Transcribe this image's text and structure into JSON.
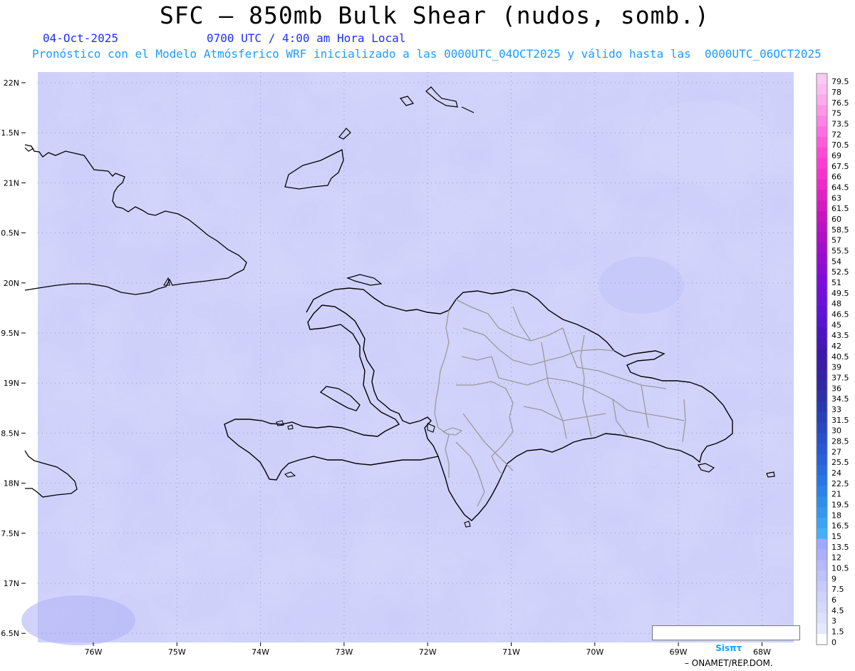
{
  "header": {
    "title": "SFC – 850mb Bulk Shear (nudos, somb.)",
    "date": "04-Oct-2025",
    "valid_time": "0700 UTC / 4:00 am Hora Local",
    "model_info": "Pronóstico con el Modelo Atmósferico WRF inicializado a las 0000UTC_04OCT2025 y válido hasta las  0000UTC_06OCT2025"
  },
  "map": {
    "lat_labels": [
      "22N",
      "1.5N",
      "21N",
      "0.5N",
      "20N",
      "9.5N",
      "19N",
      "8.5N",
      "18N",
      "7.5N",
      "17N",
      "6.5N"
    ],
    "lon_labels": [
      "76W",
      "75W",
      "74W",
      "73W",
      "72W",
      "71W",
      "70W",
      "69W",
      "68W"
    ],
    "field_color": "#cbcdfa",
    "coast_color": "#000000",
    "border_color": "#9a9a9a"
  },
  "colorbar": {
    "labels": [
      "79.5",
      "78",
      "76.5",
      "75",
      "73.5",
      "72",
      "70.5",
      "69",
      "67.5",
      "66",
      "64.5",
      "63",
      "61.5",
      "60",
      "58.5",
      "57",
      "55.5",
      "54",
      "52.5",
      "51",
      "49.5",
      "48",
      "46.5",
      "45",
      "43.5",
      "42",
      "40.5",
      "39",
      "37.5",
      "36",
      "34.5",
      "33",
      "31.5",
      "30",
      "28.5",
      "27",
      "25.5",
      "24",
      "22.5",
      "21",
      "19.5",
      "18",
      "16.5",
      "15",
      "13.5",
      "12",
      "10.5",
      "9",
      "7.5",
      "6",
      "4.5",
      "3",
      "1.5",
      "0"
    ],
    "colors": [
      "#ffc8f5",
      "#ffbcf2",
      "#ffaaee",
      "#ff96ea",
      "#ff82e6",
      "#ff6ee2",
      "#ff5cdc",
      "#ff4ad7",
      "#ff3cd2",
      "#f832cd",
      "#ee2ac8",
      "#e222c4",
      "#d51ac1",
      "#c814c0",
      "#bc10c4",
      "#b00ec8",
      "#a40ccc",
      "#980cd0",
      "#8c0cd6",
      "#800cdc",
      "#760ee0",
      "#6c10dc",
      "#6212d6",
      "#5814d0",
      "#4e14c4",
      "#4616b8",
      "#3e18ae",
      "#3a1ca8",
      "#3622a6",
      "#3228a6",
      "#2e30aa",
      "#2a38b0",
      "#2840b8",
      "#2848c2",
      "#2850ca",
      "#2858d2",
      "#2862da",
      "#286ce0",
      "#2876e6",
      "#2a82ea",
      "#2e8eee",
      "#3298f2",
      "#3aa4f6",
      "#44b0fa",
      "#a0a8ff",
      "#aab0ff",
      "#b4baff",
      "#bec2ff",
      "#c6caff",
      "#ced2ff",
      "#d6d9ff",
      "#dee0ff",
      "#e6e8ff",
      "#ffffff"
    ]
  },
  "credit": {
    "logo": "Sisπτ",
    "text": "– ONAMET/REP.DOM."
  }
}
